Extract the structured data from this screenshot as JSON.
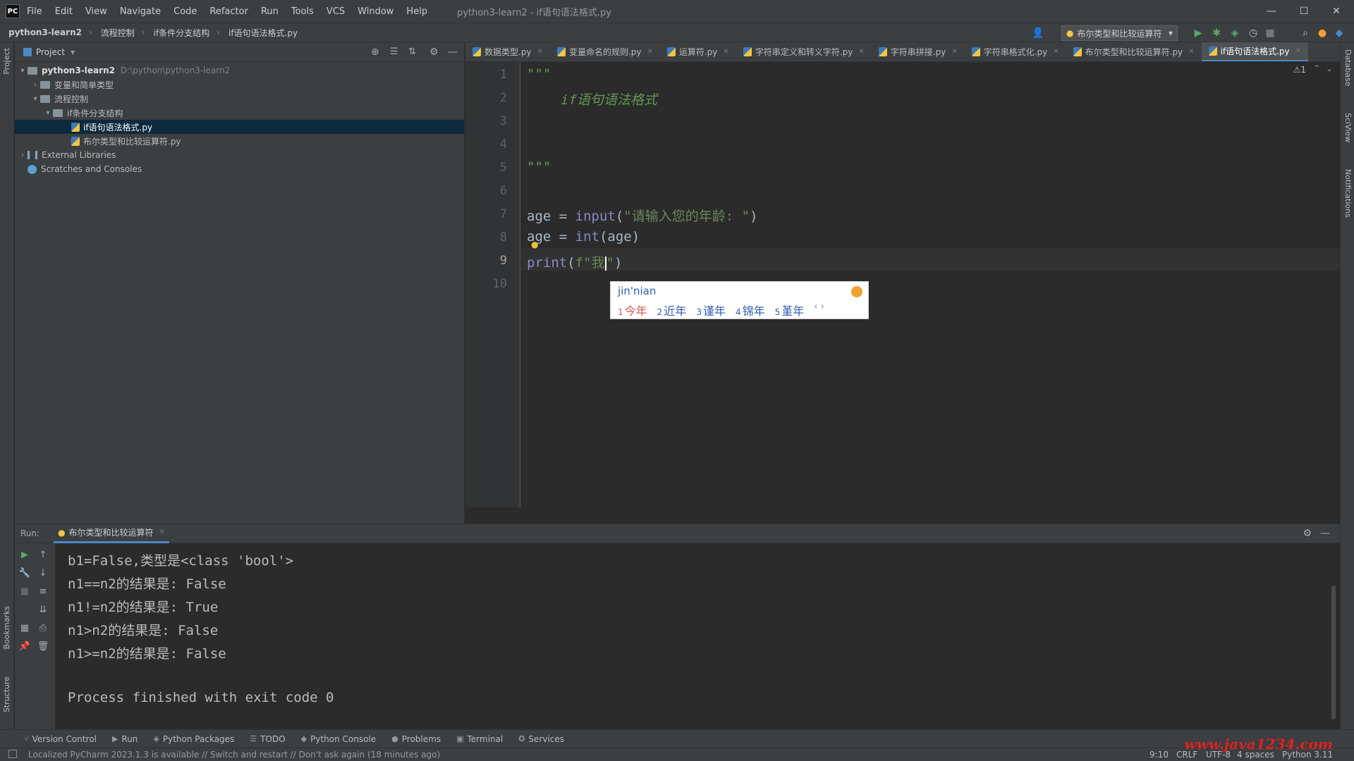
{
  "menubar": {
    "logo": "PC",
    "items": [
      "File",
      "Edit",
      "View",
      "Navigate",
      "Code",
      "Refactor",
      "Run",
      "Tools",
      "VCS",
      "Window",
      "Help"
    ],
    "window_title": "python3-learn2 - if语句语法格式.py"
  },
  "navbar": {
    "crumbs": [
      "python3-learn2",
      "流程控制",
      "if条件分支结构",
      "if语句语法格式.py"
    ],
    "run_config": "布尔类型和比较运算符"
  },
  "project": {
    "title": "Project",
    "root": "python3-learn2",
    "root_path": "D:\\python\\python3-learn2",
    "tree": [
      {
        "label": "变量和简单类型",
        "type": "folder",
        "depth": 1,
        "expanded": false
      },
      {
        "label": "流程控制",
        "type": "folder",
        "depth": 1,
        "expanded": true
      },
      {
        "label": "if条件分支结构",
        "type": "folder",
        "depth": 2,
        "expanded": true
      },
      {
        "label": "if语句语法格式.py",
        "type": "file",
        "depth": 3,
        "selected": true
      },
      {
        "label": "布尔类型和比较运算符.py",
        "type": "file",
        "depth": 3
      }
    ],
    "external_libraries": "External Libraries",
    "scratches": "Scratches and Consoles"
  },
  "tabs": [
    "数据类型.py",
    "变量命名的规则.py",
    "运算符.py",
    "字符串定义和转义字符.py",
    "字符串拼接.py",
    "字符串格式化.py",
    "布尔类型和比较运算符.py",
    "if语句语法格式.py"
  ],
  "active_tab_index": 7,
  "editor": {
    "line_numbers": [
      "1",
      "2",
      "3",
      "4",
      "5",
      "6",
      "7",
      "8",
      "9",
      "10"
    ],
    "current_line": 9,
    "doc_open": "\"\"\"",
    "doc_text": "if语句语法格式",
    "doc_close": "\"\"\"",
    "line7": {
      "var": "age = ",
      "fn": "input",
      "open": "(",
      "str": "\"请输入您的年龄: \"",
      "close": ")"
    },
    "line8": {
      "var": "age = ",
      "fn": "int",
      "rest": "(age)"
    },
    "line9": {
      "fn": "print",
      "open": "(",
      "str": "f\"我",
      "str_end": "\"",
      "close": ")"
    },
    "warning_count": "⚠1"
  },
  "ime": {
    "composition": "jin'nian",
    "candidates": [
      {
        "num": "1",
        "text": "今年"
      },
      {
        "num": "2",
        "text": "近年"
      },
      {
        "num": "3",
        "text": "谨年"
      },
      {
        "num": "4",
        "text": "锦年"
      },
      {
        "num": "5",
        "text": "堇年"
      }
    ],
    "nav": "‹ ›"
  },
  "run": {
    "label": "Run:",
    "tab": "布尔类型和比较运算符",
    "output": [
      "b1=False,类型是<class 'bool'>",
      "n1==n2的结果是: False",
      "n1!=n2的结果是: True",
      "n1>n2的结果是: False",
      "n1>=n2的结果是: False",
      "",
      "Process finished with exit code 0"
    ]
  },
  "left_strip": {
    "project": "Project",
    "bookmarks": "Bookmarks",
    "structure": "Structure"
  },
  "right_strip": {
    "database": "Database",
    "sciview": "SciView",
    "notifications": "Notifications"
  },
  "toolwindows": [
    "Version Control",
    "Run",
    "Python Packages",
    "TODO",
    "Python Console",
    "Problems",
    "Terminal",
    "Services"
  ],
  "status": {
    "message": "Localized PyCharm 2023.1.3 is available // Switch and restart // Don't ask again (18 minutes ago)",
    "position": "9:10",
    "line_sep": "CRLF",
    "encoding": "UTF-8",
    "indent": "4 spaces",
    "interpreter": "Python 3.11"
  },
  "watermark": "www.java1234.com",
  "colors": {
    "accent": "#4a88c7",
    "selection": "#0d293e",
    "string": "#6a8759",
    "builtin": "#8888c6"
  }
}
